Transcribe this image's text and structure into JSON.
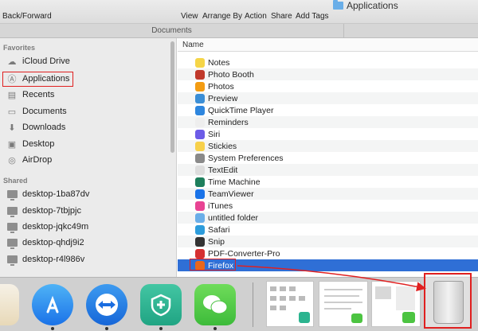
{
  "window": {
    "title": "Applications"
  },
  "toolbar": {
    "back_forward": "Back/Forward",
    "view": "View",
    "arrange_by": "Arrange By",
    "action": "Action",
    "share": "Share",
    "add_tags": "Add Tags"
  },
  "tabs": {
    "documents": "Documents"
  },
  "sidebar": {
    "favorites_header": "Favorites",
    "favorites": [
      {
        "label": "iCloud Drive",
        "icon": "cloud-icon"
      },
      {
        "label": "Applications",
        "icon": "applications-icon"
      },
      {
        "label": "Recents",
        "icon": "recents-icon"
      },
      {
        "label": "Documents",
        "icon": "document-icon"
      },
      {
        "label": "Downloads",
        "icon": "download-icon"
      },
      {
        "label": "Desktop",
        "icon": "desktop-icon"
      },
      {
        "label": "AirDrop",
        "icon": "airdrop-icon"
      }
    ],
    "shared_header": "Shared",
    "shared": [
      {
        "label": "desktop-1ba87dv"
      },
      {
        "label": "desktop-7tbjpjc"
      },
      {
        "label": "desktop-jqkc49m"
      },
      {
        "label": "desktop-qhdj9i2"
      },
      {
        "label": "desktop-r4l986v"
      }
    ]
  },
  "list": {
    "column_header": "Name",
    "rows": [
      {
        "name": "Notes",
        "color": "#f5d547"
      },
      {
        "name": "Photo Booth",
        "color": "#c0392b"
      },
      {
        "name": "Photos",
        "color": "#f39c12"
      },
      {
        "name": "Preview",
        "color": "#3b8ed6"
      },
      {
        "name": "QuickTime Player",
        "color": "#2e86de"
      },
      {
        "name": "Reminders",
        "color": "#eeeeee"
      },
      {
        "name": "Siri",
        "color": "#6c5ce7"
      },
      {
        "name": "Stickies",
        "color": "#f7d04a"
      },
      {
        "name": "System Preferences",
        "color": "#8a8a8a"
      },
      {
        "name": "TextEdit",
        "color": "#dddddd"
      },
      {
        "name": "Time Machine",
        "color": "#1e7f5c"
      },
      {
        "name": "TeamViewer",
        "color": "#1a73e8"
      },
      {
        "name": "iTunes",
        "color": "#e84393"
      },
      {
        "name": "untitled folder",
        "color": "#6aaee8"
      },
      {
        "name": "Safari",
        "color": "#2d9cdb"
      },
      {
        "name": "Snip",
        "color": "#333333"
      },
      {
        "name": "PDF-Converter-Pro",
        "color": "#d63031"
      },
      {
        "name": "Firefox",
        "color": "#e8671c"
      }
    ],
    "selected": "Firefox"
  },
  "dock": {
    "apps": [
      {
        "icon": "textedit-icon"
      },
      {
        "icon": "app-store-icon"
      },
      {
        "icon": "teamviewer-icon"
      },
      {
        "icon": "plus-app-icon"
      },
      {
        "icon": "wechat-icon"
      }
    ],
    "trash": {
      "icon": "trash-icon"
    }
  },
  "colors": {
    "selection": "#2f6fd6",
    "highlight": "#e02020"
  }
}
